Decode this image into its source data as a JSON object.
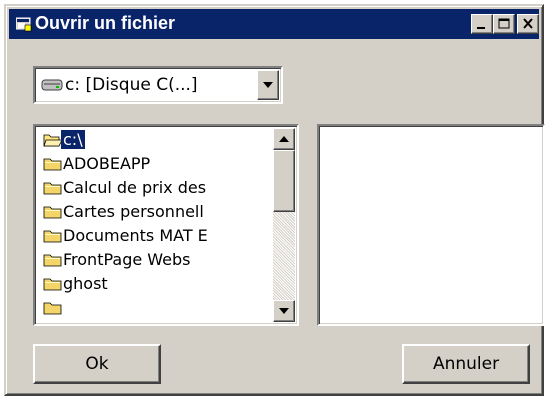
{
  "window": {
    "title": "Ouvrir un fichier",
    "title_bar_color": "#0a246a",
    "face_color": "#d4d0c8",
    "controls": [
      "minimize-icon",
      "maximize-icon",
      "close-icon"
    ]
  },
  "drive_select": {
    "value": "c: [Disque C(...]",
    "icon": "drive-icon"
  },
  "folder_list": {
    "items": [
      {
        "label": "c:\\",
        "icon": "open-folder-icon",
        "selected": true
      },
      {
        "label": "ADOBEAPP",
        "icon": "folder-icon",
        "selected": false
      },
      {
        "label": "Calcul de prix des",
        "icon": "folder-icon",
        "selected": false
      },
      {
        "label": "Cartes personnell",
        "icon": "folder-icon",
        "selected": false
      },
      {
        "label": "Documents MAT E",
        "icon": "folder-icon",
        "selected": false
      },
      {
        "label": "FrontPage Webs",
        "icon": "folder-icon",
        "selected": false
      },
      {
        "label": "ghost",
        "icon": "folder-icon",
        "selected": false
      }
    ]
  },
  "file_list": {
    "items": []
  },
  "buttons": {
    "ok": "Ok",
    "cancel": "Annuler"
  }
}
